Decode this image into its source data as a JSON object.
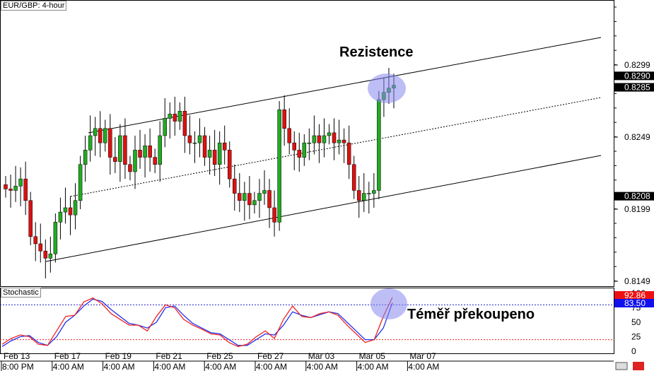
{
  "chart_data": {
    "type": "candlestick",
    "title": "EUR/GBP: 4-hour",
    "price_axis": {
      "ticks": [
        "0.8299",
        "0.8249",
        "0.8199",
        "0.8149"
      ],
      "min": 0.8145,
      "max": 0.832
    },
    "price_markers": {
      "high": "0.8290",
      "current": "0.8285",
      "low": "0.8208"
    },
    "annotations": {
      "resistance": "Rezistence",
      "overbought": "Téměř překoupeno"
    },
    "closes": [
      0.8213,
      0.8212,
      0.8215,
      0.822,
      0.8205,
      0.818,
      0.8175,
      0.817,
      0.8165,
      0.8168,
      0.819,
      0.8197,
      0.82,
      0.8195,
      0.8205,
      0.823,
      0.824,
      0.825,
      0.8255,
      0.8245,
      0.8255,
      0.8235,
      0.8232,
      0.825,
      0.823,
      0.8225,
      0.824,
      0.8235,
      0.8243,
      0.8235,
      0.823,
      0.825,
      0.8262,
      0.8265,
      0.826,
      0.8267,
      0.825,
      0.8245,
      0.8245,
      0.825,
      0.8235,
      0.824,
      0.823,
      0.8245,
      0.824,
      0.822,
      0.821,
      0.8205,
      0.821,
      0.8202,
      0.8205,
      0.821,
      0.8212,
      0.82,
      0.819,
      0.8268,
      0.8255,
      0.8245,
      0.824,
      0.8235,
      0.8245,
      0.8245,
      0.825,
      0.8245,
      0.825,
      0.8252,
      0.8245,
      0.8247,
      0.8245,
      0.823,
      0.8212,
      0.8205,
      0.821,
      0.821,
      0.8212,
      0.8275,
      0.828,
      0.8283,
      0.8285
    ],
    "stochastic": {
      "title": "Stochastic",
      "ticks": [
        "100",
        "75",
        "50",
        "25",
        "0"
      ],
      "levels": [
        80,
        20
      ],
      "values": {
        "k": "92.86",
        "d": "83.50"
      },
      "k": [
        12,
        22,
        28,
        25,
        12,
        10,
        35,
        60,
        62,
        85,
        92,
        82,
        65,
        55,
        45,
        45,
        35,
        60,
        80,
        75,
        55,
        45,
        38,
        30,
        28,
        15,
        8,
        12,
        25,
        35,
        22,
        55,
        78,
        60,
        58,
        65,
        68,
        62,
        45,
        30,
        15,
        20,
        60,
        93
      ],
      "d": [
        8,
        18,
        25,
        27,
        15,
        10,
        25,
        50,
        62,
        78,
        90,
        86,
        72,
        60,
        48,
        45,
        40,
        50,
        75,
        78,
        62,
        48,
        40,
        32,
        30,
        20,
        10,
        10,
        20,
        30,
        28,
        45,
        68,
        62,
        58,
        63,
        68,
        65,
        50,
        35,
        20,
        20,
        40,
        83.5
      ]
    },
    "x_dates": [
      "Feb 13",
      "Feb 17",
      "Feb 19",
      "Feb 21",
      "Feb 25",
      "Feb 27",
      "Mar 03",
      "Mar 05",
      "Mar 07"
    ],
    "x_times": [
      "8:00 PM",
      "4:00 AM",
      "4:00 AM",
      "4:00 AM",
      "4:00 AM",
      "4:00 AM",
      "4:00 AM",
      "4:00 AM",
      "4:00 AM"
    ],
    "colors": {
      "up": "#22aa22",
      "down": "#dd1111",
      "k": "#ee2222",
      "d": "#2233ee",
      "highlight": "#8888ee"
    }
  }
}
